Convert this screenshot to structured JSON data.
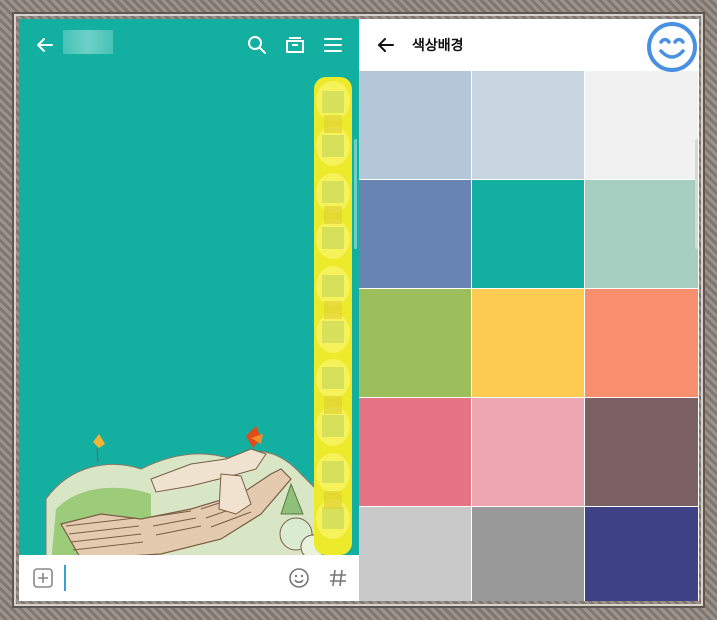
{
  "chat": {
    "background_color": "#13afa1",
    "top_icons": [
      "back-arrow-icon",
      "search-icon",
      "archive-icon",
      "menu-icon"
    ],
    "bottom_icons": [
      "add-icon",
      "emoji-icon",
      "hashtag-icon"
    ]
  },
  "palette": {
    "title": "색상배경",
    "swatches": [
      "#b4c7d9",
      "#c8d5e0",
      "#f1f1f1",
      "#6884b3",
      "#13afa1",
      "#a5cdc0",
      "#9dbf5b",
      "#fdcb51",
      "#f78f6f",
      "#e57585",
      "#eca7b2",
      "#7c6164",
      "#c9c9c9",
      "#999999",
      "#3f4187"
    ]
  },
  "overlay": {
    "icon": "smiley-face-icon",
    "color": "#4a90e2"
  }
}
